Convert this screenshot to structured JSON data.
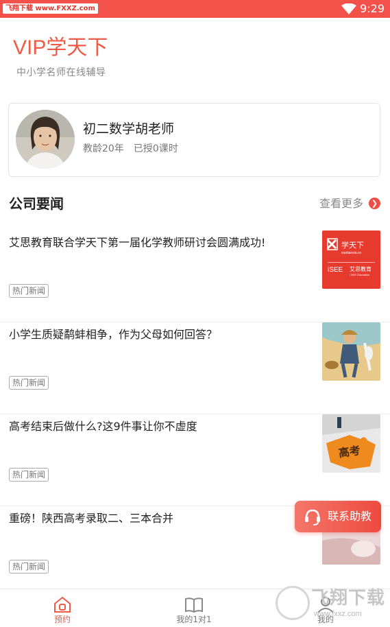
{
  "status_bar": {
    "watermark": "飞翔下载 www.FXXZ.com",
    "time": "9:29"
  },
  "header": {
    "app_title": "VIP学天下",
    "subtitle": "中小学名师在线辅导"
  },
  "teacher": {
    "name": "初二数学胡老师",
    "teaching_years": "教龄20年",
    "lessons": "已授0课时"
  },
  "news_section": {
    "title": "公司要闻",
    "more_label": "查看更多",
    "items": [
      {
        "title": "艾思教育联合学天下第一届化学教师研讨会圆满成功!",
        "tag": "热门新闻",
        "thumb": "logo-thumbnail"
      },
      {
        "title": "小学生质疑鹬蚌相争，作为父母如何回答？",
        "tag": "热门新闻",
        "thumb": "cartoon-thumbnail"
      },
      {
        "title": "高考结束后做什么?这9件事让你不虚度",
        "tag": "热门新闻",
        "thumb": "puzzle-thumbnail"
      },
      {
        "title": "重磅！陕西高考录取二、三本合并",
        "tag": "热门新闻",
        "thumb": "photo-thumbnail"
      }
    ],
    "thumb1": {
      "brand_cn": "学天下",
      "brand_pinyin": "xuetianxia.cn",
      "partner_logo": "iSEE",
      "partner_cn": "艾思教育",
      "partner_en": "i SEE Education"
    },
    "thumb3_word": "高考"
  },
  "contact_button": {
    "label": "联系助教",
    "icon": "headset-icon"
  },
  "bottom_nav": {
    "tabs": [
      {
        "label": "预约",
        "icon": "home-icon",
        "active": true
      },
      {
        "label": "我的1对1",
        "icon": "book-icon",
        "active": false
      },
      {
        "label": "我的",
        "icon": "user-icon",
        "active": false
      }
    ]
  },
  "watermark_bottom": {
    "brand": "飞翔下载",
    "url": "www.fxxz.com"
  },
  "colors": {
    "accent": "#ef5a45",
    "status_bar": "#f2524a",
    "tag_border": "#aaaaaa"
  }
}
